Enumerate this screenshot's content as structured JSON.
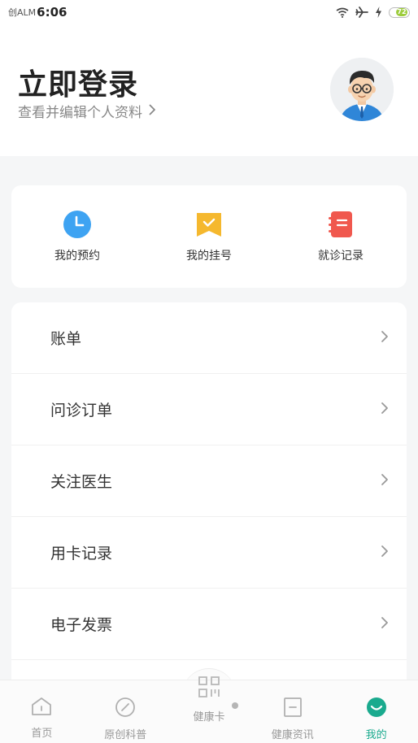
{
  "status_bar": {
    "carrier": "创ALM",
    "time": "6:06",
    "battery": "72"
  },
  "header": {
    "login_title": "立即登录",
    "profile_link": "查看并编辑个人资料"
  },
  "quick_actions": [
    {
      "label": "我的预约",
      "icon": "clock-icon",
      "color": "#3ea3f2"
    },
    {
      "label": "我的挂号",
      "icon": "bookmark-check-icon",
      "color": "#f5b82e"
    },
    {
      "label": "就诊记录",
      "icon": "notebook-icon",
      "color": "#f0584e"
    }
  ],
  "menu": [
    {
      "label": "账单"
    },
    {
      "label": "问诊订单"
    },
    {
      "label": "关注医生"
    },
    {
      "label": "用卡记录"
    },
    {
      "label": "电子发票"
    }
  ],
  "tabs": [
    {
      "label": "首页",
      "icon": "home-icon"
    },
    {
      "label": "原创科普",
      "icon": "compass-icon"
    },
    {
      "label": "健康卡",
      "icon": "qr-code-icon"
    },
    {
      "label": "健康资讯",
      "icon": "news-icon"
    },
    {
      "label": "我的",
      "icon": "profile-icon",
      "active": true
    }
  ],
  "colors": {
    "accent": "#1aaa8e",
    "inactive": "#999999"
  }
}
